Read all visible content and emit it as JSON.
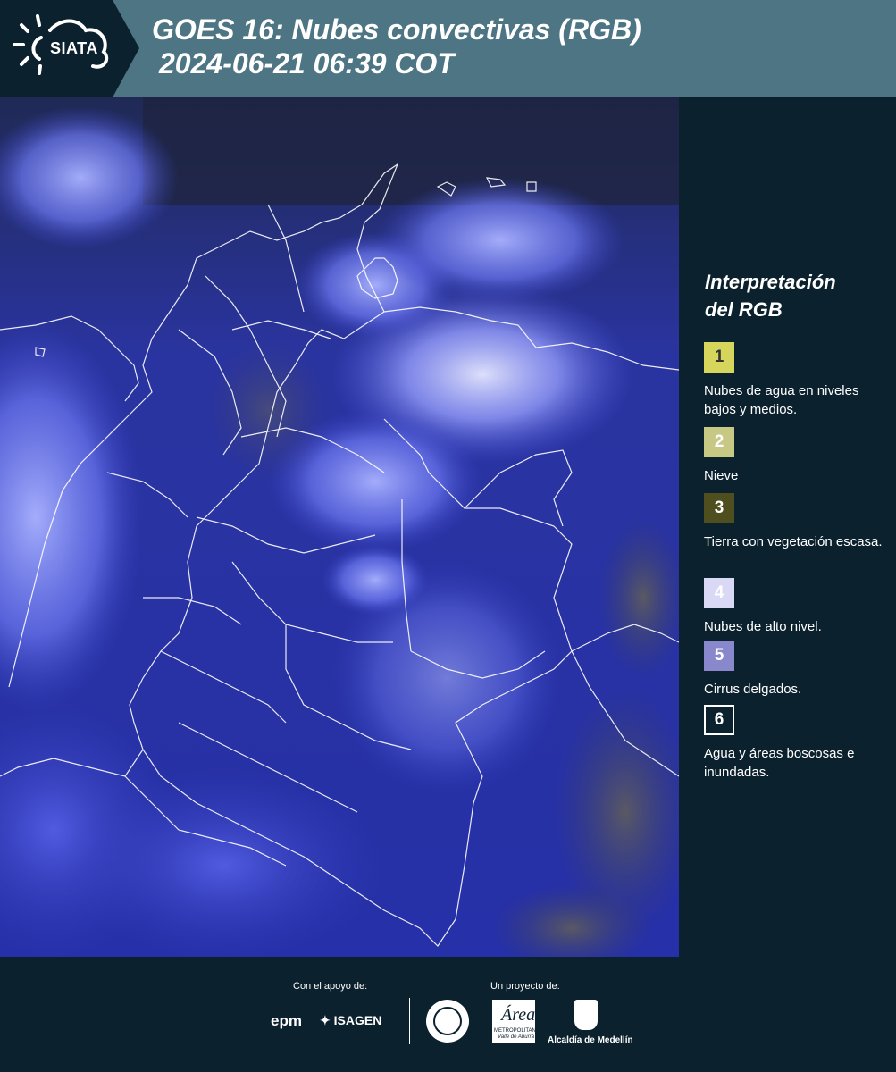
{
  "header": {
    "logo_text": "SIATA",
    "title_line1": "GOES 16: Nubes convectivas (RGB)",
    "title_line2": "2024-06-21 06:39 COT",
    "background_color": "#4d7583",
    "dark_color": "#0b212d"
  },
  "map": {
    "description_icon": "satellite-image-colombia"
  },
  "legend": {
    "title_line1": "Interpretación",
    "title_line2": "del RGB",
    "items": [
      {
        "number": "1",
        "label": "Nubes de agua en niveles bajos y medios.",
        "color": "#d6d65c",
        "text_color": "#333333"
      },
      {
        "number": "2",
        "label": "Nieve",
        "color": "#c8c885",
        "text_color": "#ffffff"
      },
      {
        "number": "3",
        "label": "Tierra con vegetación escasa.",
        "color": "#4e4e1e",
        "text_color": "#ffffff"
      },
      {
        "number": "4",
        "label": "Nubes de alto nivel.",
        "color": "#d9d9f5",
        "text_color": "#ffffff"
      },
      {
        "number": "5",
        "label": "Cirrus delgados.",
        "color": "#8a88cc",
        "text_color": "#ffffff"
      },
      {
        "number": "6",
        "label": "Agua y áreas boscosas e inundadas.",
        "color": "#0b212d",
        "text_color": "#ffffff"
      }
    ]
  },
  "footer": {
    "support_label": "Con el apoyo de:",
    "project_label": "Un proyecto de:",
    "sponsor_epm": "epm",
    "sponsor_isagen": "ISAGEN",
    "amva_text_1": "METROPOLITANA",
    "amva_text_2": "Valle de Aburrá",
    "alcaldia": "Alcaldía de Medellín"
  }
}
